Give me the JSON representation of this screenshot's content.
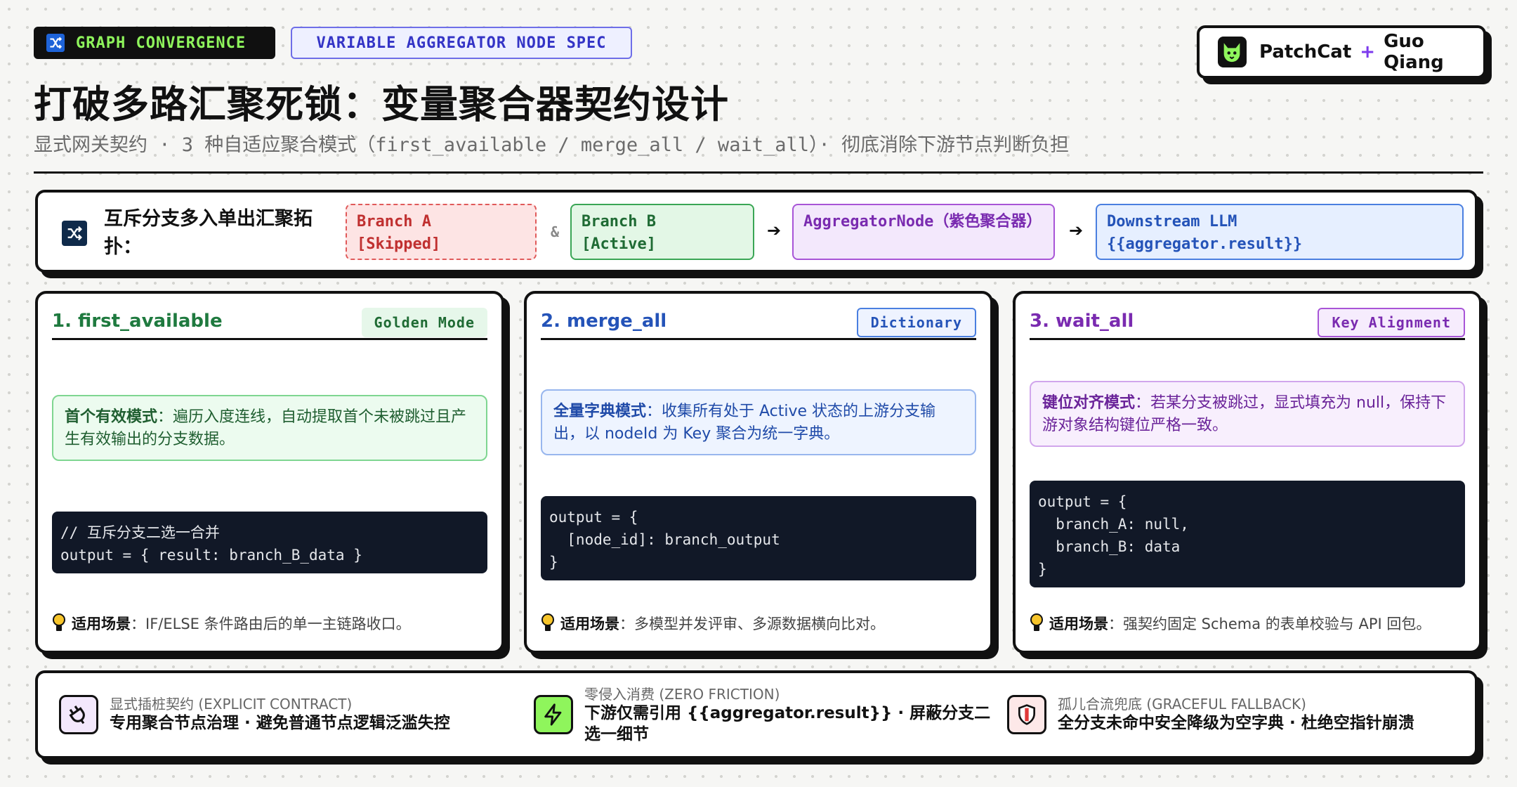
{
  "header": {
    "tag_primary": "GRAPH CONVERGENCE",
    "tag_spec": "VARIABLE AGGREGATOR NODE SPEC",
    "brand_name": "PatchCat",
    "brand_plus": "+",
    "brand_author": "Guo Qiang",
    "title": "打破多路汇聚死锁：变量聚合器契约设计",
    "subtitle": "显式网关契约 · 3 种自适应聚合模式（first_available / merge_all / wait_all）· 彻底消除下游节点判断负担"
  },
  "topology": {
    "label": "互斥分支多入单出汇聚拓扑：",
    "branch_a": [
      "Branch A",
      "[Skipped]"
    ],
    "amp": "&",
    "branch_b": [
      "Branch B",
      "[Active]"
    ],
    "arrow": "➔",
    "aggregator": "AggregatorNode（紫色聚合器）",
    "downstream": [
      "Downstream LLM",
      "{{aggregator.result}}"
    ]
  },
  "modes": [
    {
      "title": "1. first_available",
      "badge": "Golden Mode",
      "desc_bold": "首个有效模式",
      "desc_text": "：遍历入度连线，自动提取首个未被跳过且产生有效输出的分支数据。",
      "code": "// 互斥分支二选一合并\noutput = { result: branch_B_data }",
      "scene_bold": "适用场景",
      "scene_text": "：IF/ELSE 条件路由后的单一主链路收口。"
    },
    {
      "title": "2. merge_all",
      "badge": "Dictionary",
      "desc_bold": "全量字典模式",
      "desc_text": "：收集所有处于 Active 状态的上游分支输出，以 nodeId 为 Key 聚合为统一字典。",
      "code": "output = {\n  [node_id]: branch_output\n}",
      "scene_bold": "适用场景",
      "scene_text": "：多模型并发评审、多源数据横向比对。"
    },
    {
      "title": "3. wait_all",
      "badge": "Key Alignment",
      "desc_bold": "键位对齐模式",
      "desc_text": "：若某分支被跳过，显式填充为 null，保持下游对象结构键位严格一致。",
      "code": "output = {\n  branch_A: null,\n  branch_B: data\n}",
      "scene_bold": "适用场景",
      "scene_text": "：强契约固定 Schema 的表单校验与 API 回包。"
    }
  ],
  "features": [
    {
      "icon": "plug-icon",
      "sub": "显式插桩契约 (EXPLICIT CONTRACT)",
      "main": "专用聚合节点治理 · 避免普通节点逻辑泛滥失控"
    },
    {
      "icon": "lightning-icon",
      "sub": "零侵入消费 (ZERO FRICTION)",
      "main": "下游仅需引用 {{aggregator.result}} · 屏蔽分支二选一细节"
    },
    {
      "icon": "shield-icon",
      "sub": "孤儿合流兜底 (GRACEFUL FALLBACK)",
      "main": "全分支未命中安全降级为空字典 · 杜绝空指针崩溃"
    }
  ],
  "colors": {
    "accent_green": "#8ff55c",
    "mode1": "#1f7a3f",
    "mode2": "#2453b8",
    "mode3": "#7a2bb0"
  }
}
